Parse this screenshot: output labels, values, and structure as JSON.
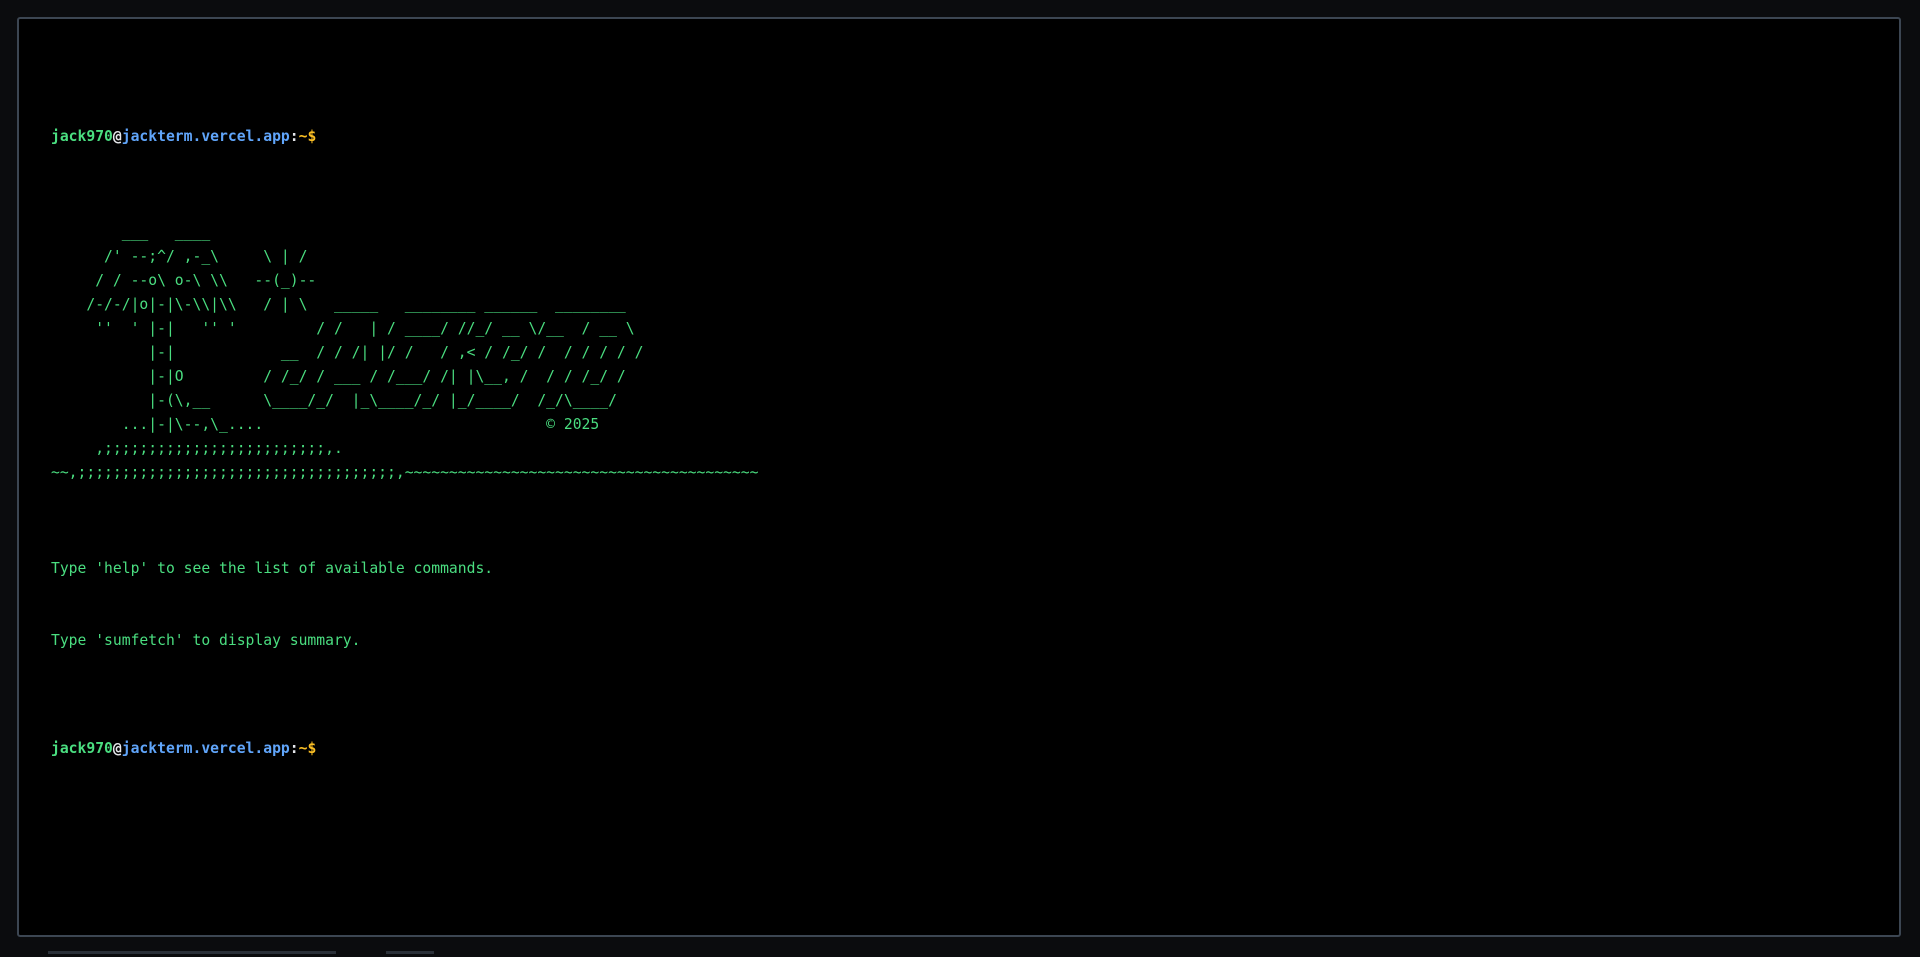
{
  "prompt": {
    "user": "jack970",
    "at": "@",
    "host": "jackterm.vercel.app",
    "colon": ":",
    "path": "~",
    "symbol": "$"
  },
  "banner_ascii": "        ___   ____\n      /' --;^/ ,-_\\     \\ | /\n     / / --o\\ o-\\ \\\\   --(_)--\n    /-/-/|o|-|\\-\\\\|\\\\   / | \\   _____   ________ ______  ________\n     ''  ' |-|   '' '         / /   | / ____/ //_/ __ \\/__  / __ \\\n           |-|            __  / / /| |/ /   / ,< / /_/ /  / / / / /\n           |-|O         / /_/ / ___ / /___/ /| |\\__, /  / / /_/ /\n           |-(\\,__      \\____/_/  |_\\____/_/ |_/____/  /_/\\____/\n        ...|-|\\--,\\_....                                © 2025\n     ,;;;;;;;;;;;;;;;;;;;;;;;;;,.\n~~,;;;;;;;;;;;;;;;;;;;;;;;;;;;;;;;;;;;;,~~~~~~~~~~~~~~~~~~~~~~~~~~~~~~~~~~~~~~~~",
  "messages": {
    "help_hint": "Type 'help' to see the list of available commands.",
    "sumfetch_hint": "Type 'sumfetch' to display summary."
  }
}
